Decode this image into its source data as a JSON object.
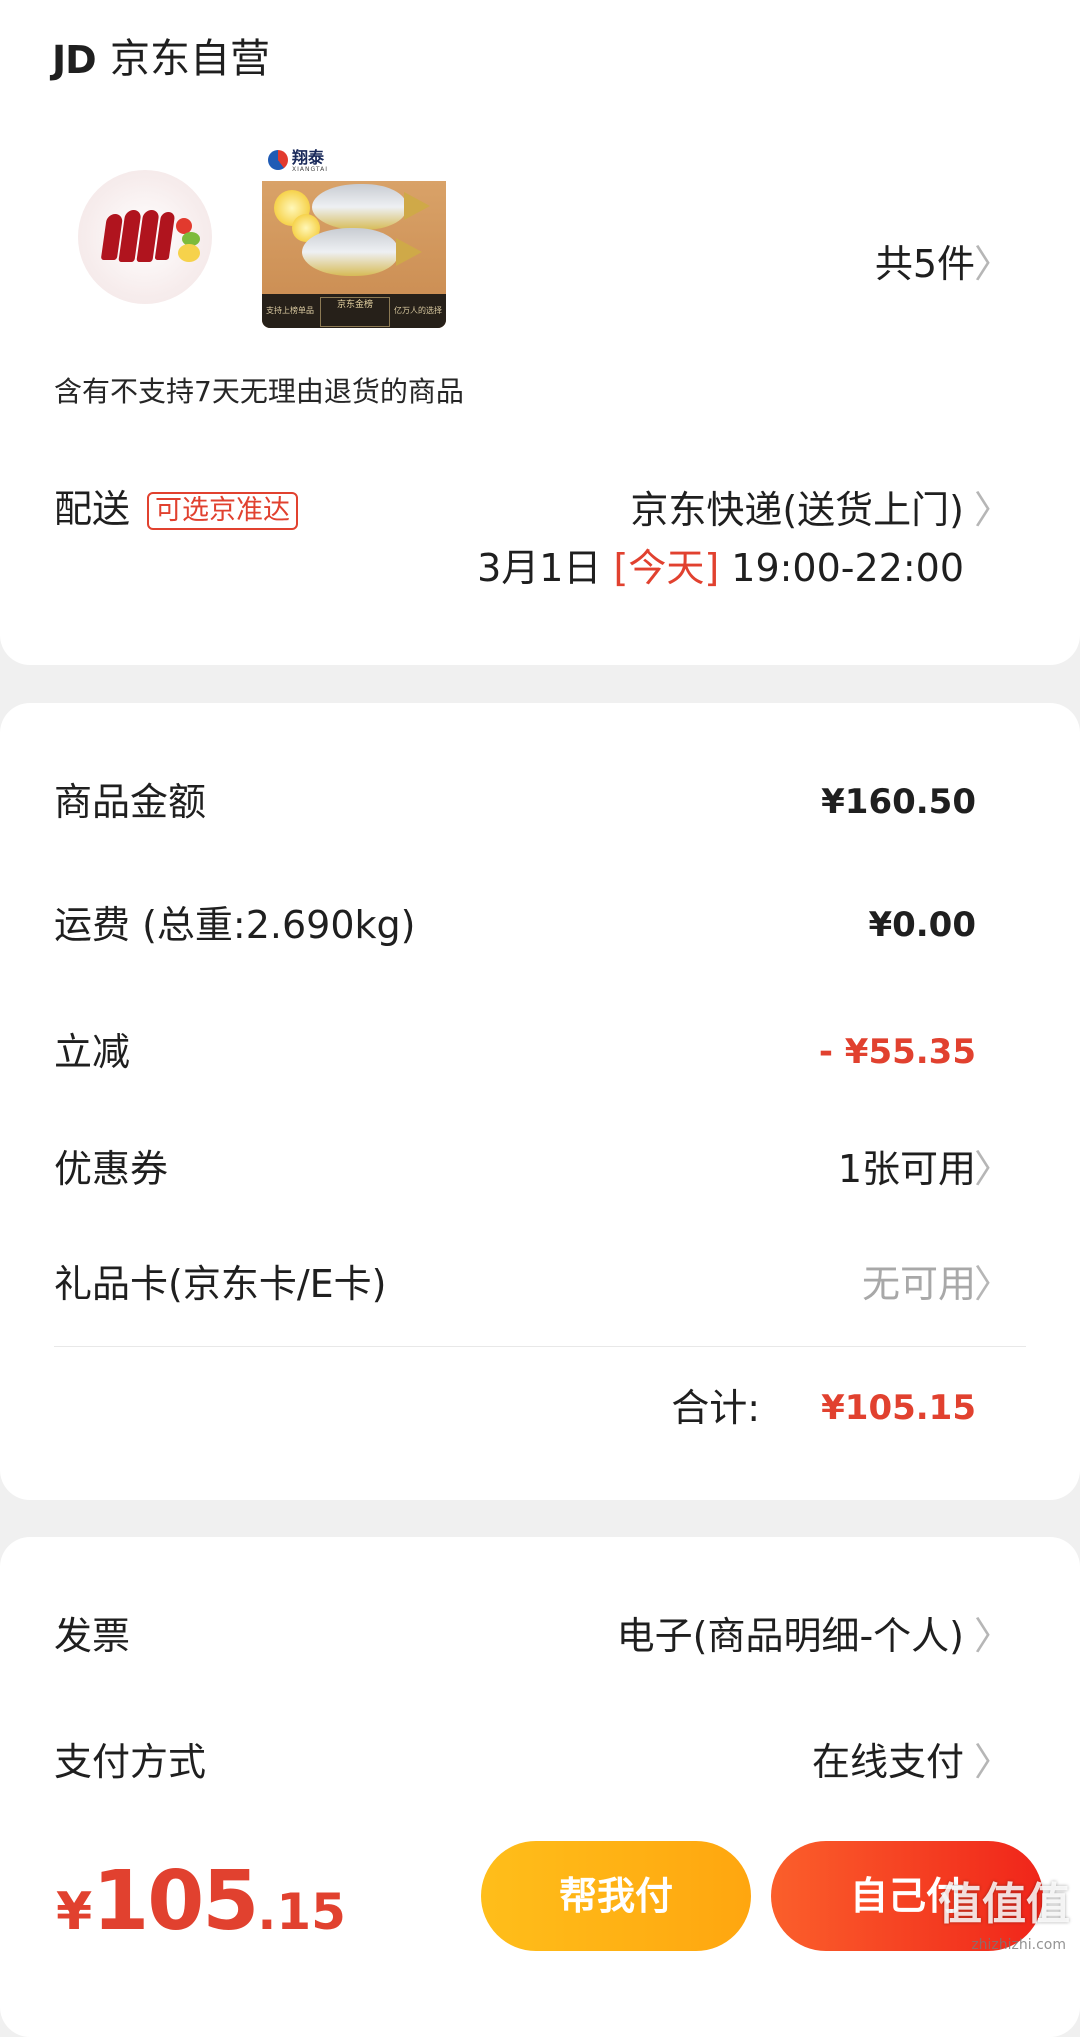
{
  "header": {
    "logo_text": "JD",
    "shop_name": "京东自营"
  },
  "products": {
    "brand_name": "翔泰",
    "brand_sub": "XIANGTAI",
    "banner_left": "支持上榜单品",
    "banner_mid": "京东金榜",
    "banner_right": "亿万人的选择",
    "count_label": "共5件"
  },
  "return_note": "含有不支持7天无理由退货的商品",
  "delivery": {
    "label": "配送",
    "tag": "可选京准达",
    "method": "京东快递(送货上门)",
    "date": "3月1日",
    "today": "[今天]",
    "time_range": "19:00-22:00"
  },
  "price_rows": [
    {
      "label": "商品金额",
      "value": "¥160.50"
    },
    {
      "label": "运费 (总重:2.690kg)",
      "value": "¥0.00"
    },
    {
      "label": "立减",
      "value": "- ¥55.35"
    },
    {
      "label": "优惠券",
      "value": "1张可用"
    },
    {
      "label": "礼品卡(京东卡/E卡)",
      "value": "无可用"
    }
  ],
  "total": {
    "label": "合计:",
    "value": "¥105.15"
  },
  "options": [
    {
      "label": "发票",
      "value": "电子(商品明细-个人)"
    },
    {
      "label": "支付方式",
      "value": "在线支付"
    }
  ],
  "bottom": {
    "currency": "¥",
    "amount_int": "105",
    "amount_dec": ".15",
    "help_pay": "帮我付",
    "self_pay": "自己付"
  },
  "watermark": {
    "logo": "值值值",
    "url": "zhizhizhi.com"
  },
  "icons": {
    "chevron": "chevron-right-icon"
  },
  "colors": {
    "accent_red": "#e1412f",
    "help_pay_bg": "#ffb414",
    "self_pay_bg": "#f2301e"
  }
}
